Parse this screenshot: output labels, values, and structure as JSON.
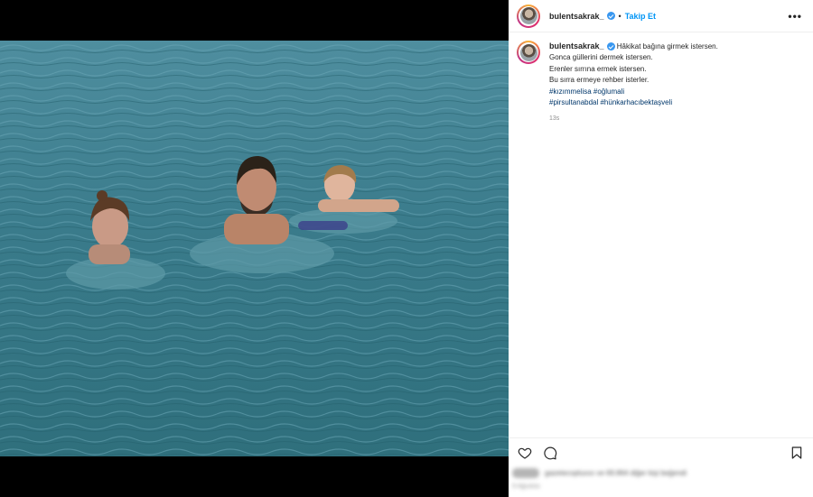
{
  "post": {
    "username": "bulentsakrak_",
    "follow_label": "Takip Et",
    "separator": "•",
    "more_label": "•••",
    "caption": {
      "first_line": "Hâkikat bağına girmek istersen.",
      "lines": [
        "Gonca güllerini dermek istersen.",
        "Erenler sırrına ermek istersen.",
        "Bu sırra ermeye rehber isterler."
      ],
      "hashtags": [
        "#kızımmelisa #oğlumali",
        "#pirsultanabdal #hünkarhacıbektaşveli"
      ]
    },
    "time": "13s",
    "likes_text": "gazetecopluxxx ve 69.864 diğer kişi beğendi",
    "date_text": "9 Ağustos"
  },
  "icons": {
    "heart": "heart-icon",
    "comment": "comment-icon",
    "bookmark": "bookmark-icon",
    "verified": "verified-badge-icon",
    "more": "more-options-icon"
  },
  "colors": {
    "follow": "#0095f6",
    "verified": "#3897f0",
    "hashtag": "#00376b",
    "water": "#3e7d8e"
  }
}
